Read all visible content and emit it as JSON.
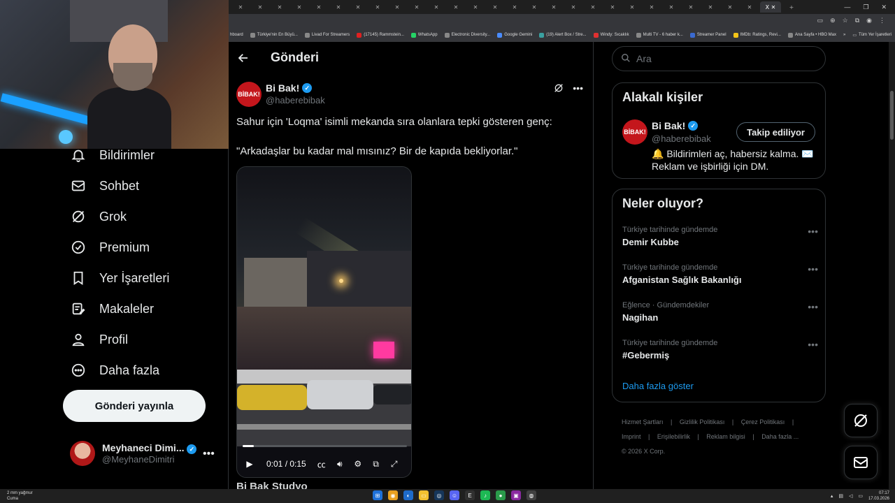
{
  "browser": {
    "bookmarks": [
      "hboard",
      "Türkiye'nin En Büyü...",
      "Livad For Streamers",
      "(17145) Rammstein...",
      "WhatsApp",
      "Electronic Diversity...",
      "Google Gemini",
      "(19) Alert Box / Stre...",
      "Windy: Sıcaklık",
      "Multi TV - 6 haber k...",
      "Streamer Panel",
      "IMDb: Ratings, Revi...",
      "Ana Sayfa • HBO Max",
      "Tüm Yer İşaretleri"
    ],
    "tab_active_label": "X"
  },
  "nav": {
    "items": [
      {
        "label": "Bildirimler",
        "icon": "bell-icon"
      },
      {
        "label": "Sohbet",
        "icon": "mail-icon"
      },
      {
        "label": "Grok",
        "icon": "grok-icon"
      },
      {
        "label": "Premium",
        "icon": "verified-badge-icon"
      },
      {
        "label": "Yer İşaretleri",
        "icon": "bookmark-icon"
      },
      {
        "label": "Makaleler",
        "icon": "article-icon"
      },
      {
        "label": "Profil",
        "icon": "person-icon"
      },
      {
        "label": "Daha fazla",
        "icon": "more-circle-icon"
      }
    ],
    "post_button": "Gönderi yayınla",
    "account_name": "Meyhaneci Dimi...",
    "account_handle": "@MeyhaneDimitri"
  },
  "main": {
    "title": "Gönderi",
    "author_name": "Bi Bak!",
    "author_handle": "@haberebibak",
    "avatar_text": "BİBAK!",
    "text_line1": "Sahur için 'Loqma' isimli mekanda sıra olanlara tepki gösteren genç:",
    "text_line2": "\"Arkadaşlar bu kadar mal mısınız? Bir de kapıda bekliyorlar.\"",
    "video_time": "0:01 / 0:15",
    "video_progress": 0.066,
    "below_video_text": "Bi Bak Studyo"
  },
  "right": {
    "search_placeholder": "Ara",
    "related_title": "Alakalı kişiler",
    "related_name": "Bi Bak!",
    "related_handle": "@haberebibak",
    "related_follow": "Takip ediliyor",
    "related_bio": "🔔 Bildirimleri aç, habersiz kalma. ✉️ Reklam ve işbirliği için DM.",
    "trends_title": "Neler oluyor?",
    "trends": [
      {
        "meta": "Türkiye tarihinde gündemde",
        "title": "Demir Kubbe"
      },
      {
        "meta": "Türkiye tarihinde gündemde",
        "title": "Afganistan Sağlık Bakanlığı"
      },
      {
        "meta": "Eğlence · Gündemdekiler",
        "title": "Nagihan"
      },
      {
        "meta": "Türkiye tarihinde gündemde",
        "title": "#Gebermiş"
      }
    ],
    "show_more": "Daha fazla göster",
    "footer_line1": [
      "Hizmet Şartları",
      "|",
      "Gizlilik Politikası",
      "|",
      "Çerez Politikası",
      "|"
    ],
    "footer_line2": [
      "Imprint",
      "|",
      "Erişilebilirlik",
      "|",
      "Reklam bilgisi",
      "|",
      "Daha fazla ..."
    ],
    "footer_line3": "© 2026 X Corp."
  },
  "taskbar": {
    "weather_line1": "2 mm yağmur",
    "weather_line2": "Cuma",
    "clock_time": "07:17",
    "clock_date": "17.03.2026"
  }
}
